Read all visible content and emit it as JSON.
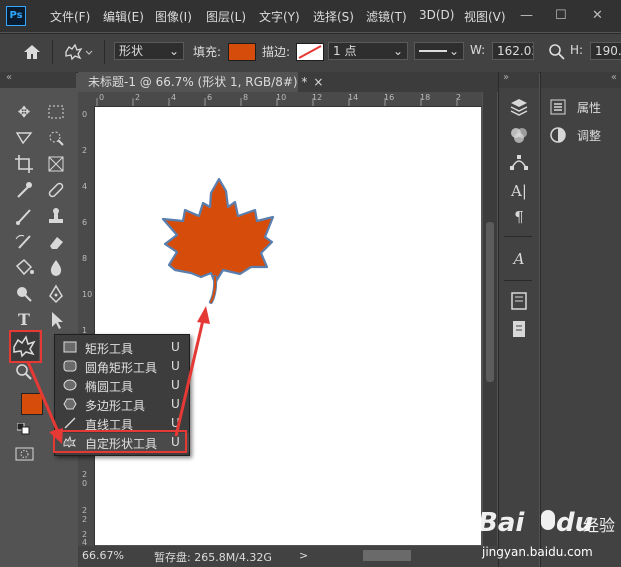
{
  "app": {
    "logo": "Ps"
  },
  "menu": [
    "文件(F)",
    "编辑(E)",
    "图像(I)",
    "图层(L)",
    "文字(Y)",
    "选择(S)",
    "滤镜(T)",
    "3D(D)",
    "视图(V)"
  ],
  "window_controls": {
    "minimize": "—",
    "maximize": "☐",
    "close": "✕"
  },
  "options_bar": {
    "mode_value": "形状",
    "fill_label": "填充:",
    "stroke_label": "描边:",
    "stroke_width_value": "1 点",
    "width_label": "W:",
    "width_value": "162.03",
    "height_label": "H:",
    "height_value": "190.",
    "fill_color": "#d64c0a"
  },
  "document": {
    "tab_title": "未标题-1 @ 66.7% (形状 1, RGB/8#) *",
    "close": "×"
  },
  "rulers": {
    "h_marks": [
      "0",
      "2",
      "4",
      "6",
      "8",
      "10",
      "12",
      "14",
      "16",
      "18",
      "2"
    ],
    "v_marks": [
      "0",
      "2",
      "4",
      "6",
      "8",
      "10",
      "1",
      "2",
      "1",
      "4",
      "1",
      "6",
      "1",
      "8",
      "2",
      "0",
      "2",
      "2",
      "2",
      "4"
    ]
  },
  "status": {
    "zoom": "66.67%",
    "scratch": "暂存盘: 265.8M/4.32G",
    "arrow": ">"
  },
  "flyout": {
    "items": [
      {
        "label": "矩形工具",
        "key": "U",
        "icon": "rectangle-icon"
      },
      {
        "label": "圆角矩形工具",
        "key": "U",
        "icon": "rounded-rectangle-icon"
      },
      {
        "label": "椭圆工具",
        "key": "U",
        "icon": "ellipse-icon"
      },
      {
        "label": "多边形工具",
        "key": "U",
        "icon": "polygon-icon"
      },
      {
        "label": "直线工具",
        "key": "U",
        "icon": "line-icon"
      },
      {
        "label": "自定形状工具",
        "key": "U",
        "icon": "custom-shape-icon"
      }
    ]
  },
  "right_panel": {
    "properties_label": "属性",
    "adjustments_label": "调整"
  },
  "colors": {
    "foreground": "#d64c0a",
    "shape_fill": "#d64c0a",
    "shape_stroke": "#5a7fae",
    "annotation": "#e53935"
  },
  "watermark": {
    "brand_a": "Bai",
    "brand_b": "du",
    "brand_c": "经验",
    "url": "jingyan.baidu.com"
  }
}
